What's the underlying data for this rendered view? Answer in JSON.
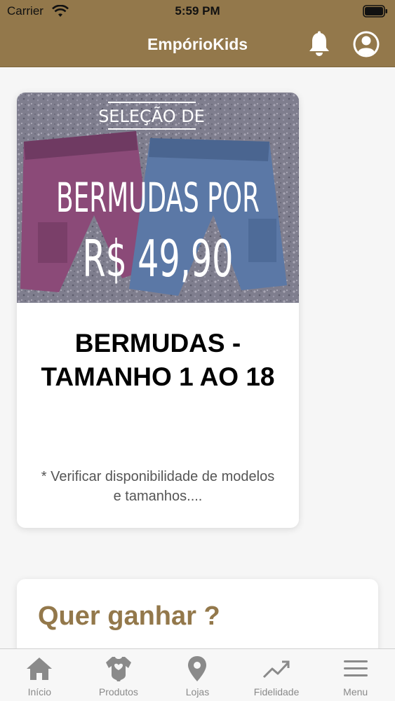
{
  "status_bar": {
    "carrier": "Carrier",
    "time": "5:59 PM"
  },
  "header": {
    "title": "EmpórioKids",
    "notification_icon": "bell-icon",
    "profile_icon": "user-circle-icon",
    "brand_color": "#93784b"
  },
  "promo": {
    "image": {
      "top_label": "SELEÇÃO DE",
      "headline": "BERMUDAS POR",
      "price": "R$ 49,90"
    },
    "title": "BERMUDAS - TAMANHO 1 AO 18",
    "note": "* Verificar disponibilidade de modelos e tamanhos...."
  },
  "section": {
    "title": "Quer ganhar ?"
  },
  "tabs": [
    {
      "label": "Início",
      "icon": "home-icon"
    },
    {
      "label": "Produtos",
      "icon": "onesie-icon"
    },
    {
      "label": "Lojas",
      "icon": "map-pin-icon"
    },
    {
      "label": "Fidelidade",
      "icon": "trending-up-icon"
    },
    {
      "label": "Menu",
      "icon": "hamburger-menu-icon"
    }
  ]
}
